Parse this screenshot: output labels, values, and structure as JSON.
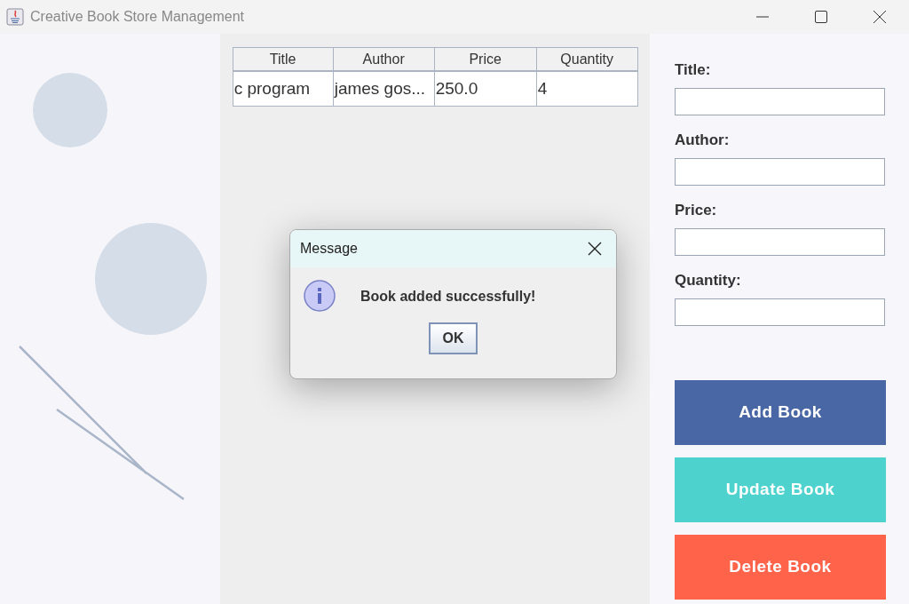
{
  "window": {
    "title": "Creative Book Store Management"
  },
  "table": {
    "columns": [
      "Title",
      "Author",
      "Price",
      "Quantity"
    ],
    "rows": [
      [
        "c program",
        "james gos...",
        "250.0",
        "4"
      ]
    ]
  },
  "form": {
    "fields": [
      {
        "label": "Title:"
      },
      {
        "label": "Author:"
      },
      {
        "label": "Price:"
      },
      {
        "label": "Quantity:"
      }
    ],
    "buttons": [
      {
        "label": "Add Book",
        "color": "#4a67a5"
      },
      {
        "label": "Update Book",
        "color": "#4ed2ce"
      },
      {
        "label": "Delete Book",
        "color": "#ff634a"
      }
    ]
  },
  "dialog": {
    "title": "Message",
    "message": "Book added successfully!",
    "button": "OK"
  }
}
